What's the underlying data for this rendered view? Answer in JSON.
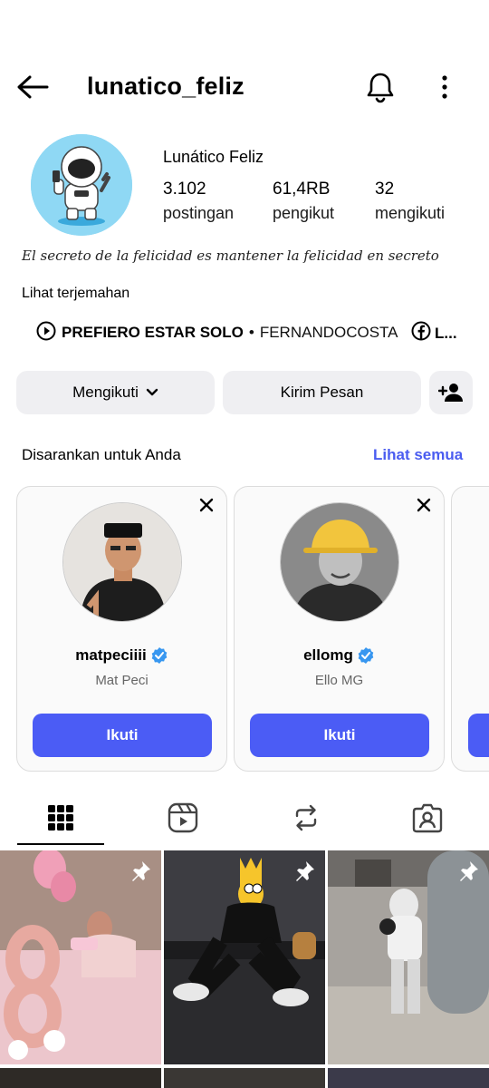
{
  "header": {
    "username": "lunatico_feliz"
  },
  "profile": {
    "display_name": "Lunático Feliz",
    "stats": [
      {
        "value": "3.102",
        "label": "postingan"
      },
      {
        "value": "61,4RB",
        "label": "pengikut"
      },
      {
        "value": "32",
        "label": "mengikuti"
      }
    ],
    "bio": "El secreto de la felicidad es mantener la felicidad en secreto",
    "translate_label": "Lihat terjemahan",
    "music": {
      "title": "PREFIERO ESTAR SOLO",
      "separator": "•",
      "artist": "FERNANDOCOSTA"
    },
    "fb_chip": "L..."
  },
  "actions": {
    "following_label": "Mengikuti",
    "message_label": "Kirim Pesan"
  },
  "suggestions": {
    "title": "Disarankan untuk Anda",
    "see_all": "Lihat semua",
    "cards": [
      {
        "handle": "matpeciiii",
        "name": "Mat Peci",
        "follow_label": "Ikuti"
      },
      {
        "handle": "ellomg",
        "name": "Ello MG",
        "follow_label": "Ikuti"
      }
    ]
  },
  "tabs": [
    "grid-icon",
    "reels-icon",
    "reposts-icon",
    "tagged-icon"
  ],
  "colors": {
    "accent": "#4b5cf5",
    "link": "#4a5cf0",
    "verified": "#3897f0"
  }
}
